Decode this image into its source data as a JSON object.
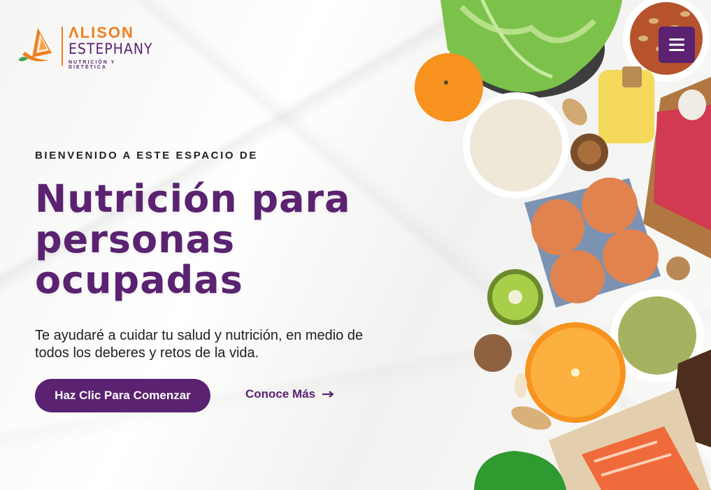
{
  "brand": {
    "name_line1": "ΛLISON",
    "name_line2": "ESTEPHANY",
    "tagline": "NUTRICIÓN Y DIETÉTICA"
  },
  "nav": {
    "menu_icon": "hamburger-menu-icon"
  },
  "hero": {
    "eyebrow": "BIENVENIDO A ESTE ESPACIO DE",
    "headline_line1": "Nutrición para",
    "headline_line2": "personas",
    "headline_line3": "ocupadas",
    "subtitle": "Te ayudaré a cuidar tu salud y nutrición, en medio de todos los deberes y retos de la vida.",
    "cta_label": "Haz Clic Para Comenzar",
    "more_label": "Conoce Más"
  },
  "colors": {
    "accent": "#5a2270",
    "brand_orange": "#f07e1e"
  }
}
